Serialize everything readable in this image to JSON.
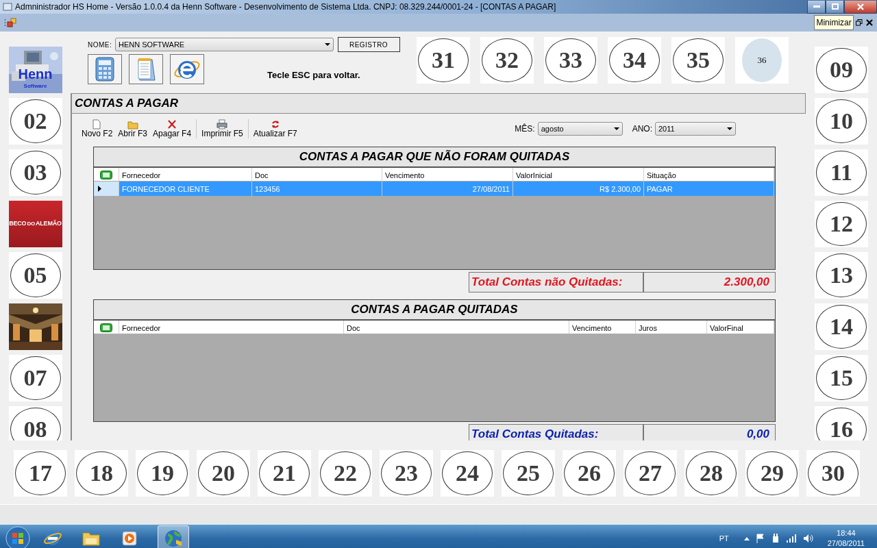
{
  "window": {
    "title": "Admninistrador HS Home - Versão 1.0.0.4 da Henn Software - Desenvolvimento de Sistema Ltda. CNPJ: 08.329.244/0001-24 - [CONTAS A PAGAR]"
  },
  "menu_strip": {
    "tooltip": "Minimizar"
  },
  "header": {
    "name_label": "NOME:",
    "name_value": "HENN SOFTWARE",
    "register_button": "REGISTRO",
    "hint": "Tecle ESC para voltar."
  },
  "top_tiles": [
    {
      "kind": "number",
      "label": "31"
    },
    {
      "kind": "number",
      "label": "32"
    },
    {
      "kind": "number",
      "label": "33"
    },
    {
      "kind": "number",
      "label": "34"
    },
    {
      "kind": "number",
      "label": "35"
    },
    {
      "kind": "circle",
      "label": "36"
    }
  ],
  "left_tiles": [
    {
      "kind": "logo",
      "lines": [
        "Henn",
        "Software"
      ]
    },
    {
      "kind": "number",
      "label": "02"
    },
    {
      "kind": "number",
      "label": "03"
    },
    {
      "kind": "badge",
      "lines": [
        "BECO",
        "DO",
        "ALEMÃO"
      ]
    },
    {
      "kind": "number",
      "label": "05"
    },
    {
      "kind": "picture"
    },
    {
      "kind": "number",
      "label": "07"
    },
    {
      "kind": "number",
      "label": "08"
    }
  ],
  "right_tiles": [
    {
      "kind": "number",
      "label": "09"
    },
    {
      "kind": "number",
      "label": "10"
    },
    {
      "kind": "number",
      "label": "11"
    },
    {
      "kind": "number",
      "label": "12"
    },
    {
      "kind": "number",
      "label": "13"
    },
    {
      "kind": "number",
      "label": "14"
    },
    {
      "kind": "number",
      "label": "15"
    },
    {
      "kind": "number",
      "label": "16"
    }
  ],
  "bottom_tiles": [
    {
      "kind": "number",
      "label": "17"
    },
    {
      "kind": "number",
      "label": "18"
    },
    {
      "kind": "number",
      "label": "19"
    },
    {
      "kind": "number",
      "label": "20"
    },
    {
      "kind": "number",
      "label": "21"
    },
    {
      "kind": "number",
      "label": "22"
    },
    {
      "kind": "number",
      "label": "23"
    },
    {
      "kind": "number",
      "label": "24"
    },
    {
      "kind": "number",
      "label": "25"
    },
    {
      "kind": "number",
      "label": "26"
    },
    {
      "kind": "number",
      "label": "27"
    },
    {
      "kind": "number",
      "label": "28"
    },
    {
      "kind": "number",
      "label": "29"
    },
    {
      "kind": "number",
      "label": "30"
    }
  ],
  "panel": {
    "title": "CONTAS A PAGAR",
    "toolbar": [
      [
        "Novo F2",
        "Abrir F3",
        "Apagar F4"
      ],
      [
        "Imprimir F5"
      ],
      [
        "Atualizar F7"
      ]
    ],
    "filters": [
      {
        "label": "MÊS:",
        "value": "agosto"
      },
      {
        "label": "ANO:",
        "value": "2011"
      }
    ],
    "unpaid": {
      "title": "CONTAS A PAGAR QUE NÃO FORAM QUITADAS",
      "columns": [
        "Fornecedor",
        "Doc",
        "Vencimento",
        "ValorInicial",
        "Situação"
      ],
      "rows": [
        {
          "cells": [
            "FORNECEDOR CLIENTE",
            "123456",
            "27/08/2011",
            "R$ 2.300,00",
            "PAGAR"
          ],
          "selected": true
        }
      ],
      "total_label": "Total Contas não Quitadas:",
      "total_value": "2.300,00"
    },
    "paid": {
      "title": "CONTAS A PAGAR QUITADAS",
      "columns": [
        "Fornecedor",
        "Doc",
        "Vencimento",
        "Juros",
        "ValorFinal"
      ],
      "total_label": "Total Contas Quitadas:",
      "total_value": "0,00"
    }
  },
  "taskbar": {
    "apps": [
      {
        "selected": false
      },
      {
        "selected": false
      },
      {
        "selected": false
      },
      {
        "selected": true
      }
    ],
    "language": "PT",
    "time": "18:44",
    "date": "27/08/2011"
  }
}
